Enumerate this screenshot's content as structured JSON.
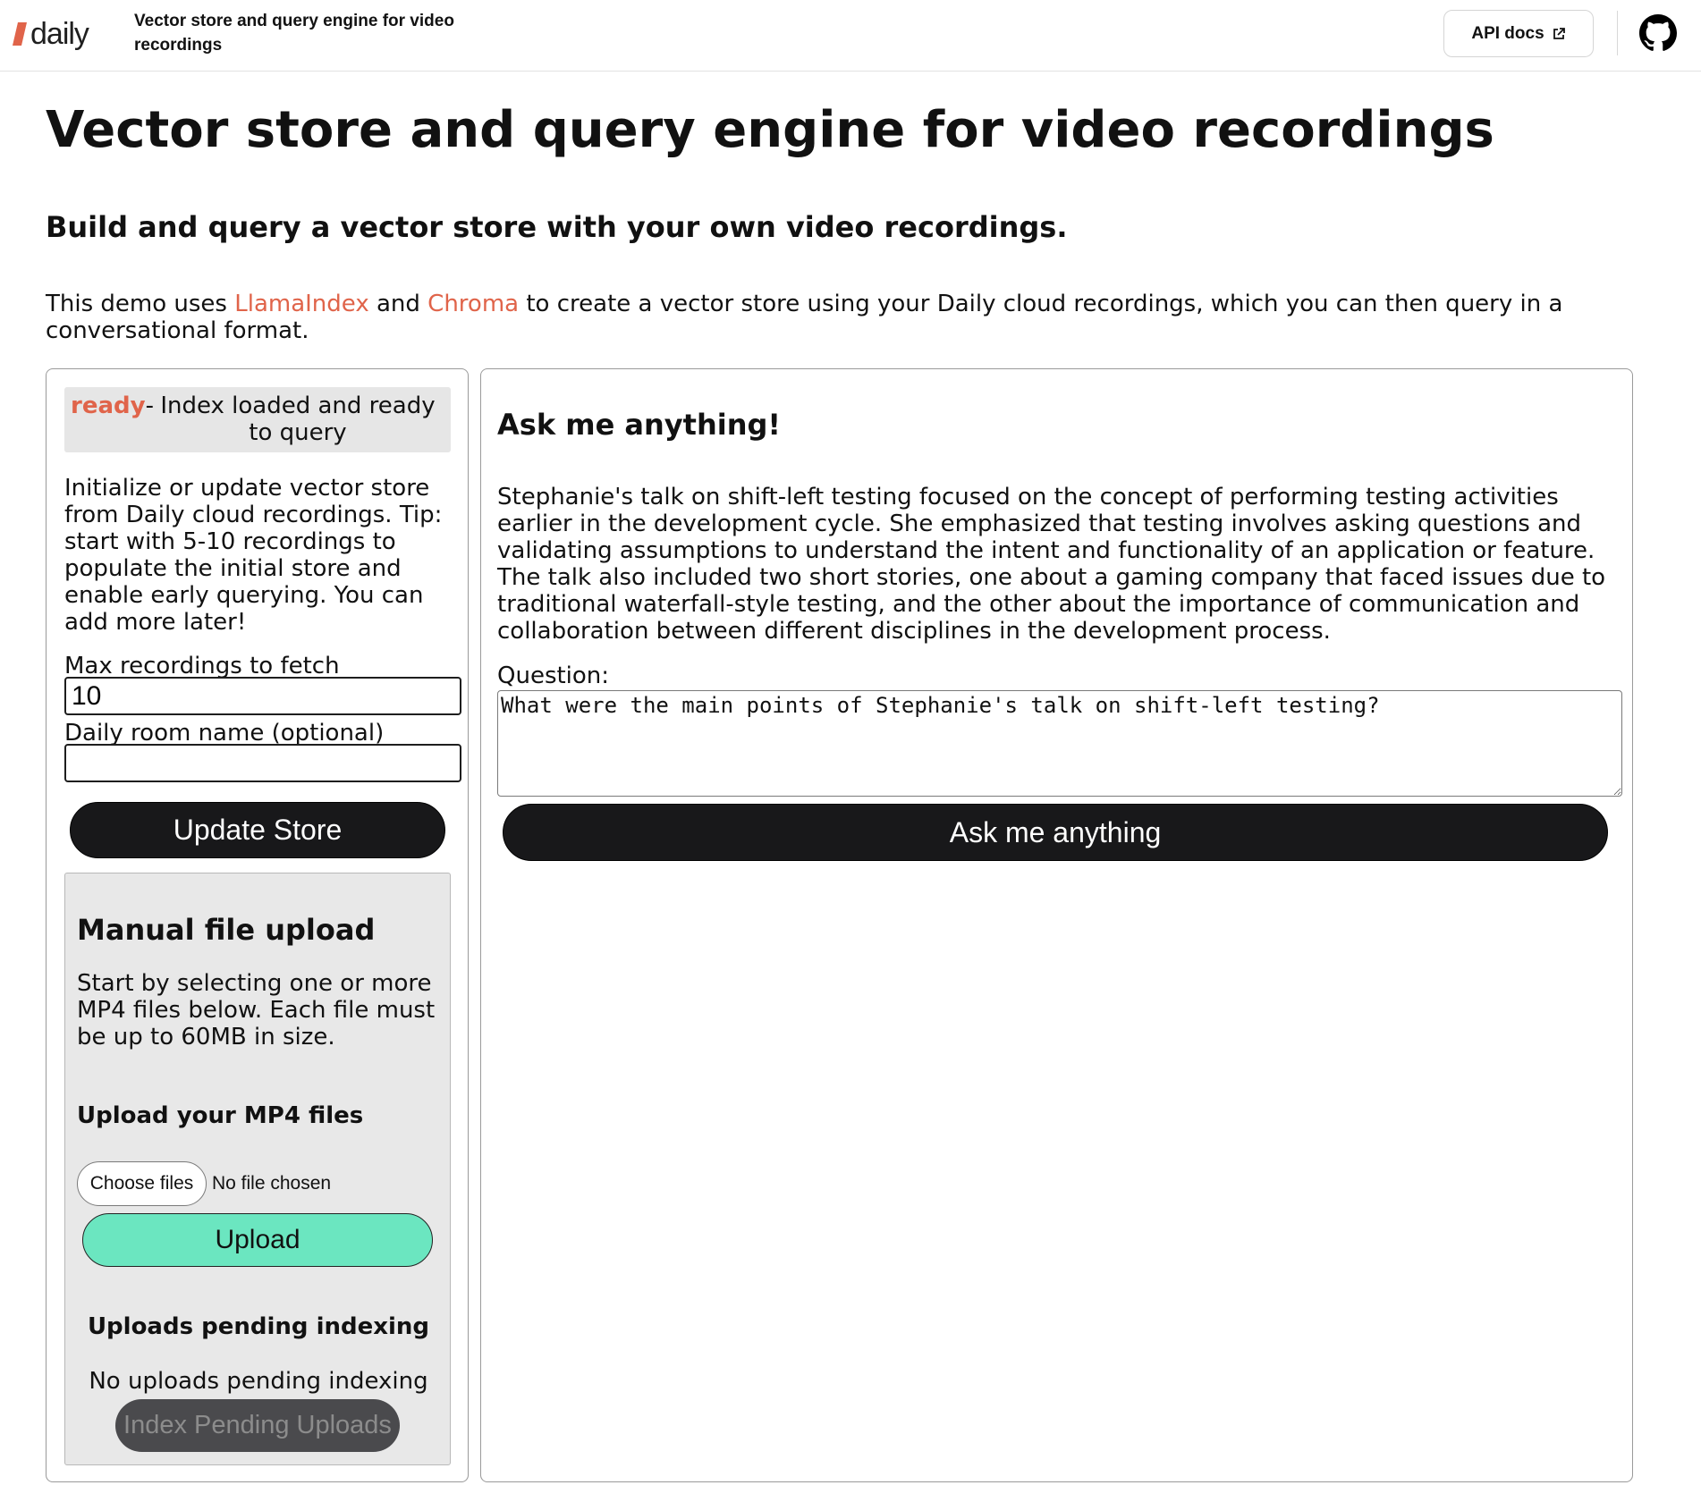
{
  "header": {
    "logo_text": "daily",
    "title": "Vector store and query engine for video recordings",
    "api_docs_label": "API docs",
    "brand_color": "#e0644a"
  },
  "page": {
    "title": "Vector store and query engine for video recordings",
    "subtitle": "Build and query a vector store with your own video recordings.",
    "intro": {
      "part1": "This demo uses ",
      "link1": "LlamaIndex",
      "part2": " and ",
      "link2": "Chroma",
      "part3": " to create a vector store using your Daily cloud recordings, which you can then query in a conversational format."
    }
  },
  "left": {
    "status_word": "ready",
    "status_dash": "-",
    "status_message": "Index loaded and ready to query",
    "description": "Initialize or update vector store from Daily cloud recordings. Tip: start with 5-10 recordings to populate the initial store and enable early querying. You can add more later!",
    "max_label": "Max recordings to fetch",
    "max_value": "10",
    "room_label": "Daily room name (optional)",
    "room_value": "",
    "update_button": "Update Store",
    "upload": {
      "title": "Manual file upload",
      "text": "Start by selecting one or more MP4 files below. Each file must be up to 60MB in size.",
      "subtitle": "Upload your MP4 files",
      "choose_label": "Choose files",
      "no_file": "No file chosen",
      "upload_button": "Upload",
      "pending_title": "Uploads pending indexing",
      "pending_empty": "No uploads pending indexing",
      "index_button": "Index Pending Uploads"
    }
  },
  "right": {
    "title": "Ask me anything!",
    "answer": "Stephanie's talk on shift-left testing focused on the concept of performing testing activities earlier in the development cycle. She emphasized that testing involves asking questions and validating assumptions to understand the intent and functionality of an application or feature. The talk also included two short stories, one about a gaming company that faced issues due to traditional waterfall-style testing, and the other about the importance of communication and collaboration between different disciplines in the development process.",
    "question_label": "Question:",
    "question_value": "What were the main points of Stephanie's talk on shift-left testing?",
    "ask_button": "Ask me anything"
  }
}
